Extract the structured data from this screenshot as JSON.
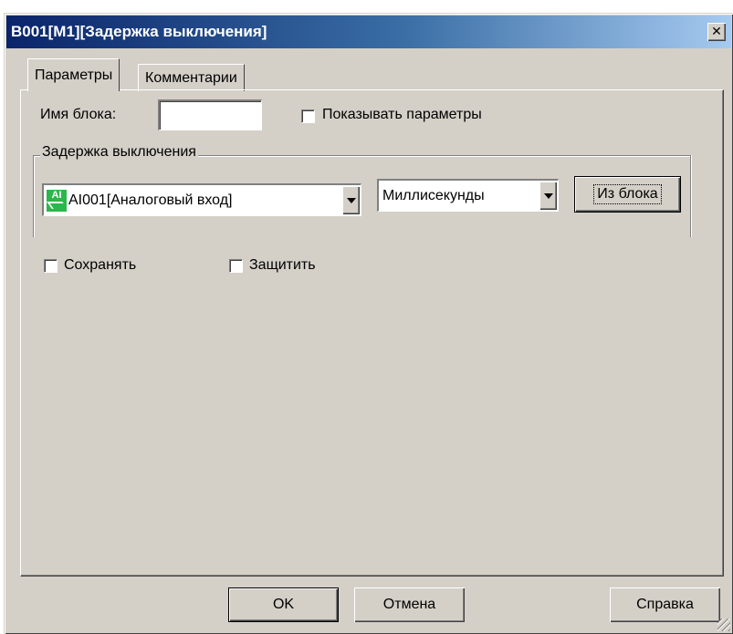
{
  "window": {
    "title": "B001[M1][Задержка выключения]",
    "close_glyph": "✕"
  },
  "tabs": [
    {
      "label": "Параметры",
      "active": true
    },
    {
      "label": "Комментарии",
      "active": false
    }
  ],
  "params": {
    "block_name_label": "Имя блока:",
    "block_name_value": "",
    "show_params_label": "Показывать параметры",
    "show_params_checked": false,
    "group_title": "Задержка выключения",
    "source_icon": "AI",
    "source_value": "AI001[Аналоговый вход]",
    "unit_value": "Миллисекунды",
    "from_block_button": "Из блока",
    "retain_label": "Сохранять",
    "retain_checked": false,
    "protect_label": "Защитить",
    "protect_checked": false
  },
  "footer": {
    "ok_label": "OK",
    "cancel_label": "Отмена",
    "help_label": "Справка"
  },
  "colors": {
    "face": "#d4d0c8",
    "title_start": "#0a246a",
    "title_end": "#a6caf0",
    "ai_icon": "#2db64b"
  }
}
